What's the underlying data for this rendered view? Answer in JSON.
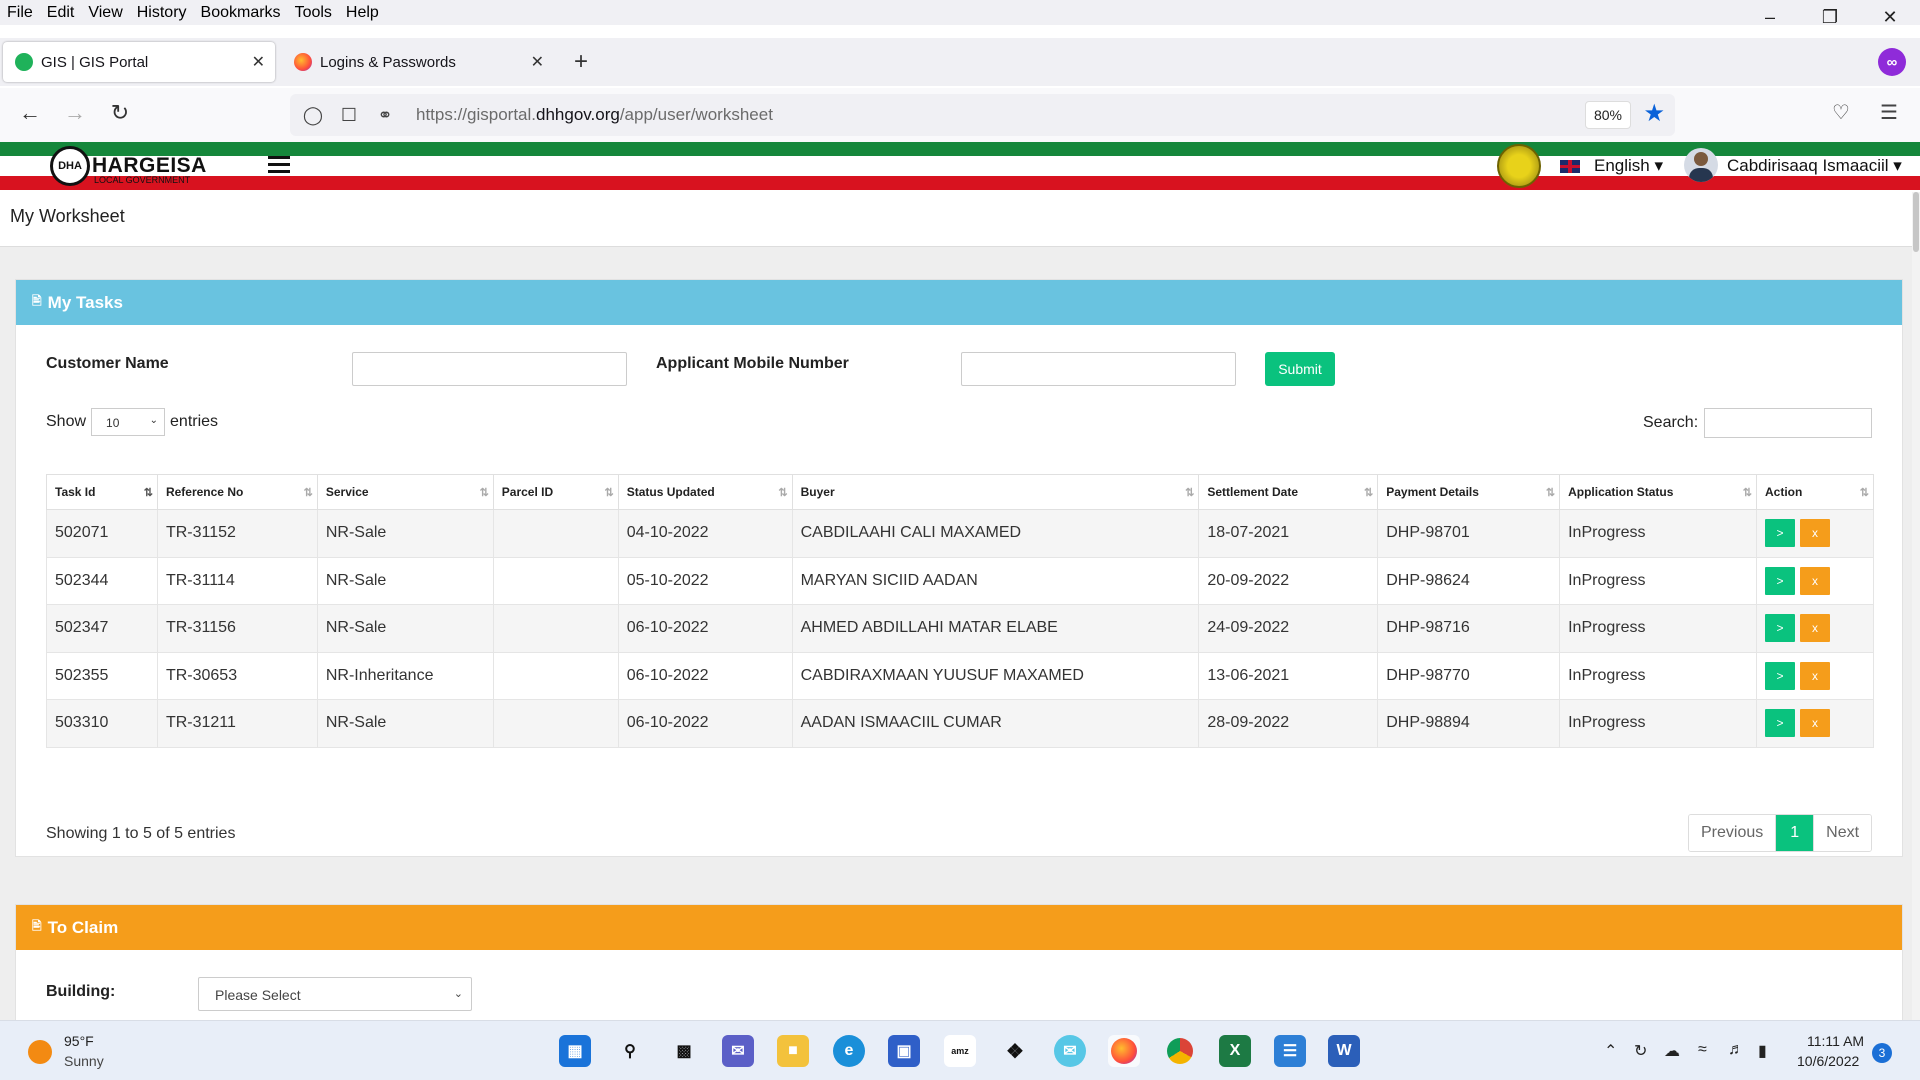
{
  "browser": {
    "menu": [
      "File",
      "Edit",
      "View",
      "History",
      "Bookmarks",
      "Tools",
      "Help"
    ],
    "tabs": [
      {
        "label": "GIS | GIS Portal",
        "active": true
      },
      {
        "label": "Logins & Passwords",
        "active": false
      }
    ],
    "url_prefix": "https://gisportal.",
    "url_domain": "dhhgov.org",
    "url_path": "/app/user/worksheet",
    "zoom": "80%"
  },
  "header": {
    "logo_text": "HARGEISA",
    "logo_sub": "LOCAL GOVERNMENT",
    "language": "English",
    "user_name": "Cabdirisaaq Ismaaciil"
  },
  "page": {
    "title": "My Worksheet"
  },
  "tasks_panel": {
    "title": "My Tasks",
    "customer_name_label": "Customer Name",
    "mobile_label": "Applicant Mobile Number",
    "submit_label": "Submit",
    "show_label": "Show",
    "entries_value": "10",
    "entries_label": "entries",
    "search_label": "Search:",
    "columns": [
      "Task Id",
      "Reference No",
      "Service",
      "Parcel ID",
      "Status Updated",
      "Buyer",
      "Settlement Date",
      "Payment Details",
      "Application Status",
      "Action"
    ],
    "rows": [
      [
        "502071",
        "TR-31152",
        "NR-Sale",
        "",
        "04-10-2022",
        "CABDILAAHI CALI MAXAMED",
        "18-07-2021",
        "DHP-98701",
        "InProgress"
      ],
      [
        "502344",
        "TR-31114",
        "NR-Sale",
        "",
        "05-10-2022",
        "MARYAN SICIID AADAN",
        "20-09-2022",
        "DHP-98624",
        "InProgress"
      ],
      [
        "502347",
        "TR-31156",
        "NR-Sale",
        "",
        "06-10-2022",
        "AHMED ABDILLAHI MATAR ELABE",
        "24-09-2022",
        "DHP-98716",
        "InProgress"
      ],
      [
        "502355",
        "TR-30653",
        "NR-Inheritance",
        "",
        "06-10-2022",
        "CABDIRAXMAAN YUUSUF MAXAMED",
        "13-06-2021",
        "DHP-98770",
        "InProgress"
      ],
      [
        "503310",
        "TR-31211",
        "NR-Sale",
        "",
        "06-10-2022",
        "AADAN ISMAACIIL CUMAR",
        "28-09-2022",
        "DHP-98894",
        "InProgress"
      ]
    ],
    "action_go_label": ">",
    "action_cancel_label": "x",
    "showing_text": "Showing 1 to 5 of 5 entries",
    "pager_prev": "Previous",
    "pager_current": "1",
    "pager_next": "Next"
  },
  "claim_panel": {
    "title": "To Claim",
    "building_label": "Building:",
    "building_placeholder": "Please Select"
  },
  "taskbar": {
    "temperature": "95°F",
    "weather": "Sunny",
    "time": "11:11 AM",
    "date": "10/6/2022",
    "notifications": "3"
  },
  "colors": {
    "tasks_header": "#69c3e0",
    "claim_header": "#f59d1b",
    "success": "#0ac27e",
    "flag_green": "#15873b",
    "flag_red": "#d8121f"
  }
}
